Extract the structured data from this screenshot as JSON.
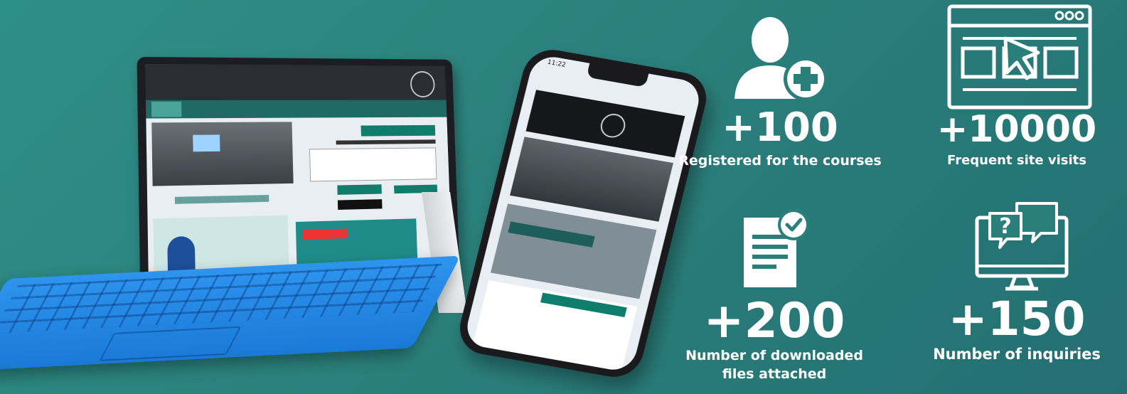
{
  "stats": [
    {
      "value": "+100",
      "label": "Registered for the courses",
      "icon": "user-add-icon"
    },
    {
      "value": "+10000",
      "label": "Frequent site visits",
      "icon": "browser-window-icon"
    },
    {
      "value": "+200",
      "label": "Number of downloaded files attached",
      "icon": "document-check-icon"
    },
    {
      "value": "+150",
      "label": "Number of inquiries",
      "icon": "monitor-question-icon"
    }
  ],
  "colors": {
    "background": "#2a7f7b",
    "text": "#ffffff",
    "keyboard": "#1f86e0"
  },
  "phone": {
    "time": "11:22"
  }
}
